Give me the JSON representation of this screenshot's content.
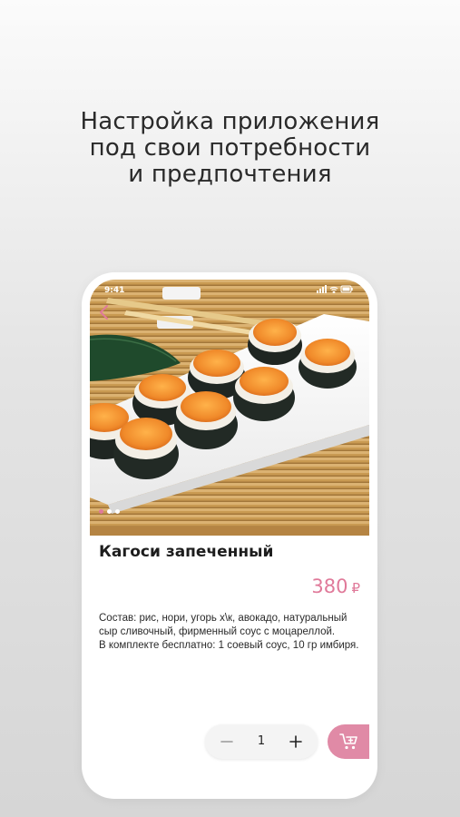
{
  "promo": {
    "line1": "Настройка приложения",
    "line2": "под свои потребности",
    "line3": "и предпочтения"
  },
  "status_bar": {
    "time": "9:41",
    "icons": [
      "signal-icon",
      "wifi-icon",
      "battery-icon"
    ]
  },
  "product": {
    "title": "Кагоси запеченный",
    "price": "380",
    "currency": "₽",
    "description_line1": "Состав: рис, нори, угорь х\\к, авокадо, натуральный сыр сливочный, фирменный соус с моцареллой.",
    "description_line2": "В комплекте бесплатно: 1 соевый соус, 10 гр имбиря."
  },
  "gallery": {
    "slides_total": 3,
    "active_slide": 1
  },
  "cart": {
    "quantity": "1"
  },
  "colors": {
    "accent": "#e08aa6",
    "price": "#e07a9a",
    "dot_active": "#e07a9a",
    "dot_inactive": "#ffffff"
  }
}
